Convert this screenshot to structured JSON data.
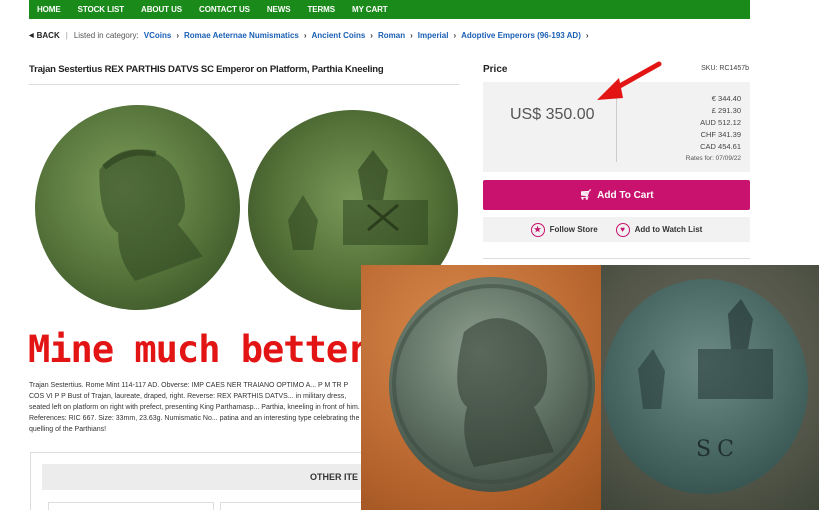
{
  "nav": [
    "HOME",
    "STOCK LIST",
    "ABOUT US",
    "CONTACT US",
    "NEWS",
    "TERMS",
    "MY CART"
  ],
  "breadcrumb": {
    "back": "BACK",
    "listed_in": "Listed in category:",
    "items": [
      "VCoins",
      "Romae Aeternae Numismatics",
      "Ancient Coins",
      "Roman",
      "Imperial",
      "Adoptive Emperors (96-193 AD)"
    ]
  },
  "product": {
    "title": "Trajan Sestertius REX PARTHIS DATVS SC Emperor on Platform, Parthia Kneeling",
    "description": "Trajan Sestertius. Rome Mint 114-117 AD. Obverse: IMP CAES NER TRAIANO OPTIMO A... P M TR P COS VI P P Bust of Trajan, laureate, draped, right. Reverse: REX PARTHIS DATVS... in military dress, seated left on platform on right with prefect, presenting King Parthamasp... Parthia, kneeling in front of him. References: RIC 667. Size: 33mm, 23.63g. Numismatic No... patina and an interesting type celebrating the quelling of the Parthians!",
    "other_items": "OTHER ITE"
  },
  "overlay_caption": "Mine much better",
  "price": {
    "label": "Price",
    "sku": "SKU: RC1457b",
    "main": "US$ 350.00",
    "rates": [
      "€ 344.40",
      "£ 291.30",
      "AUD 512.12",
      "CHF 341.39",
      "CAD 454.61"
    ],
    "rates_date": "Rates for: 07/09/22"
  },
  "actions": {
    "add_to_cart": "Add To Cart",
    "follow_store": "Follow Store",
    "watch_list": "Add to Watch List"
  },
  "photo_mark": "SC",
  "colors": {
    "nav_green": "#1a8a1a",
    "cart_pink": "#c8126e",
    "arrow_red": "#e31414"
  }
}
